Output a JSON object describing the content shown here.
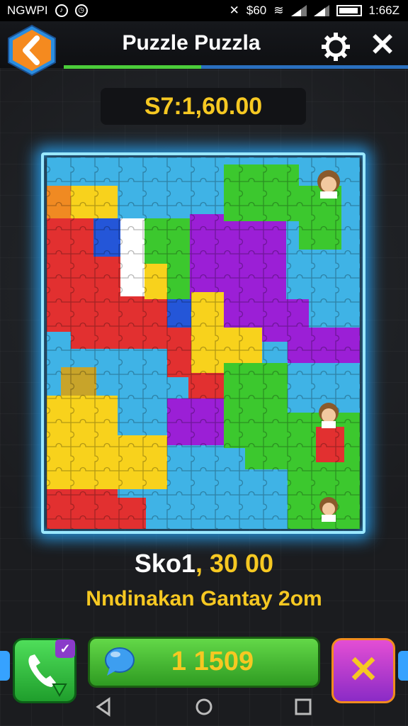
{
  "status_bar": {
    "carrier": "NGWPI",
    "data_label": "$60",
    "time": "1:66Z"
  },
  "header": {
    "title": "Puzzle Puzzla",
    "progress_fraction": 0.4
  },
  "top_score": "S7:1,60.00",
  "bottom_score": {
    "prefix": "Sko1",
    "value": ", 30 00"
  },
  "subtitle": "Nndinakan Gantay 2om",
  "coins": "1 1509",
  "badge": "✓",
  "colors": {
    "accent_yellow": "#f6c822",
    "board_blue": "#3fb3e6",
    "red": "#e23030",
    "yellow": "#f8d21c",
    "green": "#3cc82e",
    "purple": "#9b1fd6",
    "glow": "#35b4ff"
  },
  "icons": {
    "back": "chevron-left-icon",
    "settings": "gear-icon",
    "close": "close-icon",
    "phone": "phone-icon",
    "chat": "chat-bubble-icon",
    "cancel": "x-icon"
  },
  "navigation": [
    "back-triangle",
    "home-circle",
    "recents-square"
  ]
}
